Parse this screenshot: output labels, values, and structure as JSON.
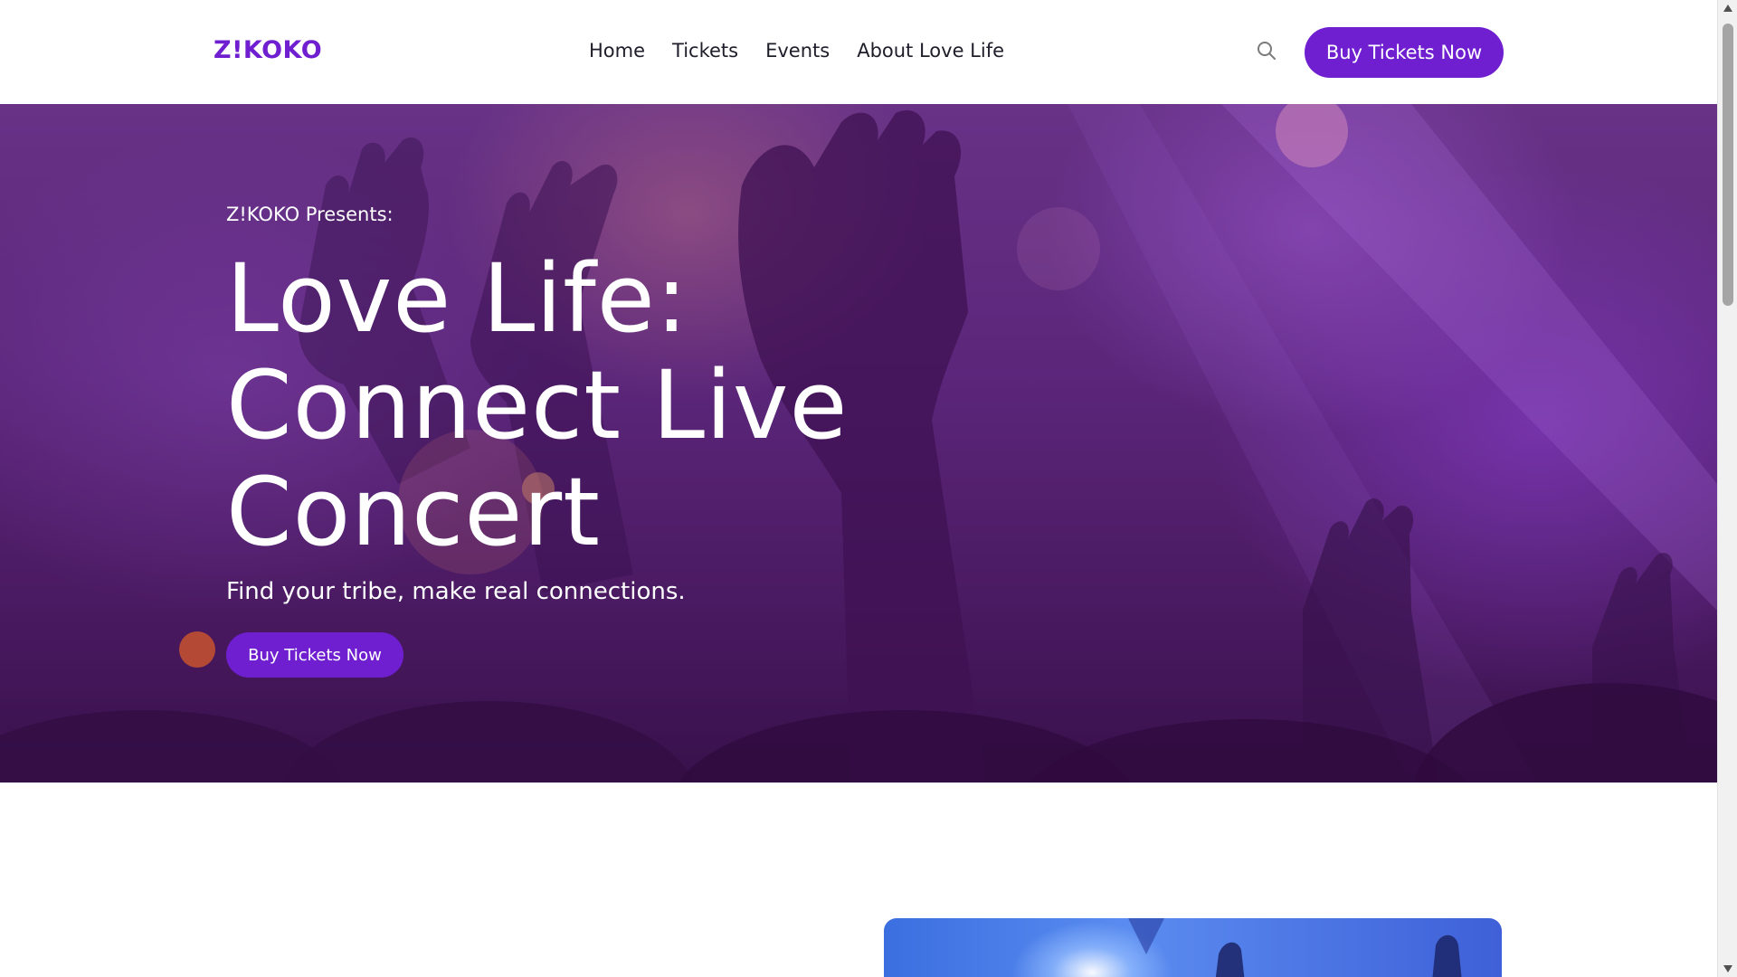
{
  "header": {
    "logo": "Z!KOKO",
    "nav": [
      "Home",
      "Tickets",
      "Events",
      "About Love Life"
    ],
    "search_icon": "search-icon",
    "cta_label": "Buy Tickets Now"
  },
  "hero": {
    "eyebrow": "Z!KOKO Presents:",
    "title": "Love Life: Connect Live Concert",
    "subtitle": "Find your tribe, make real connections.",
    "cta_label": "Buy Tickets Now"
  },
  "colors": {
    "brand": "#6f1fd0",
    "hero_overlay": "#5a2579",
    "text_dark": "#1e1e2a"
  },
  "scrollbar": {
    "up_icon": "triangle-up-icon",
    "down_icon": "triangle-down-icon"
  }
}
